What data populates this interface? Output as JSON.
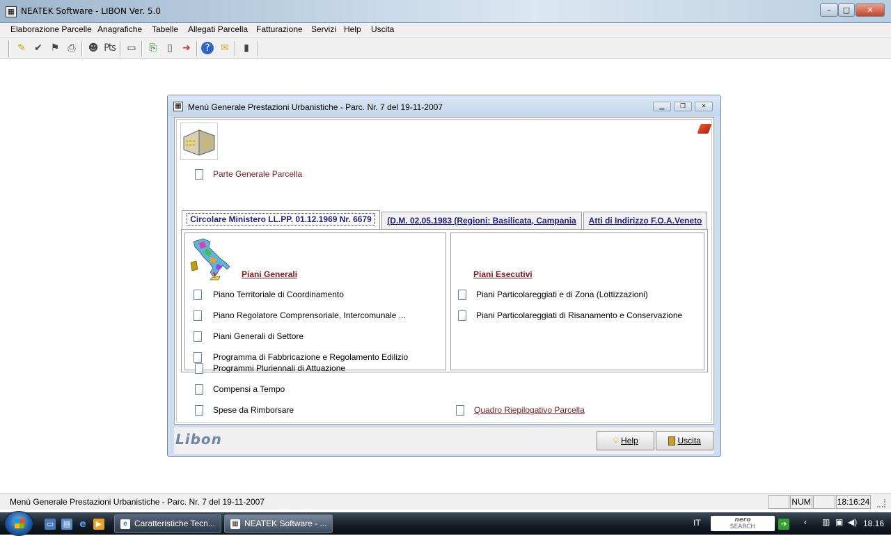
{
  "window": {
    "title": "NEATEK Software  -  LIBON Ver. 5.0",
    "app_icon": "app-icon",
    "controls": {
      "minimize": "minimize-icon",
      "maximize": "maximize-icon",
      "close": "close-icon"
    }
  },
  "menu": [
    "Elaborazione Parcelle",
    "Anagrafiche",
    "Tabelle",
    "Allegati Parcella",
    "Fatturazione",
    "Servizi",
    "Help",
    "Uscita"
  ],
  "toolbar_icons": [
    "edit-icon",
    "check-icon",
    "user-check-icon",
    "printer-icon",
    "people-icon",
    "invoice-icon",
    "window-icon",
    "print-preview-icon",
    "document-icon",
    "exit-doc-icon",
    "help-icon",
    "folder-icon",
    "door-icon"
  ],
  "dialog": {
    "title": "Menù Generale Prestazioni Urbanistiche - Parc. Nr. 7  del 19-11-2007",
    "parte_generale": "Parte Generale Parcella",
    "tabs": [
      "Circolare Ministero LL.PP. 01.12.1969 Nr. 6679",
      "(D.M. 02.05.1983 (Regioni: Basilicata, Campania",
      "Atti di Indirizzo F.O.A.Veneto"
    ],
    "piani_generali": {
      "heading": "Piani Generali",
      "items": [
        "Piano Territoriale di Coordinamento",
        "Piano Regolatore Comprensoriale, Intercomunale ...",
        "Piani Generali di Settore",
        "Programma di Fabbricazione e Regolamento Edilizio"
      ]
    },
    "piani_esecutivi": {
      "heading": "Piani Esecutivi",
      "items": [
        "Piani Particolareggiati e di Zona (Lottizzazioni)",
        "Piani Particolareggiati di Risanamento e Conservazione"
      ]
    },
    "bottom_items": [
      "Programmi Pluriennali di Attuazione",
      "Compensi a Tempo",
      "Spese da Rimborsare"
    ],
    "quadro": "Quadro Riepilogativo Parcella",
    "logo": "Libon",
    "help_button": "Help",
    "exit_button": "Uscita"
  },
  "status": {
    "message": "Menù Generale Prestazioni Urbanistiche - Parc. Nr. 7  del 19-11-2007",
    "num": "NUM",
    "time": "18:16:24"
  },
  "taskbar": {
    "tasks": [
      "Caratteristiche Tecn...",
      "NEATEK Software  - ..."
    ],
    "lang": "IT",
    "search_brand": "nero",
    "search_sub": "SEARCH",
    "clock": "18.16"
  }
}
